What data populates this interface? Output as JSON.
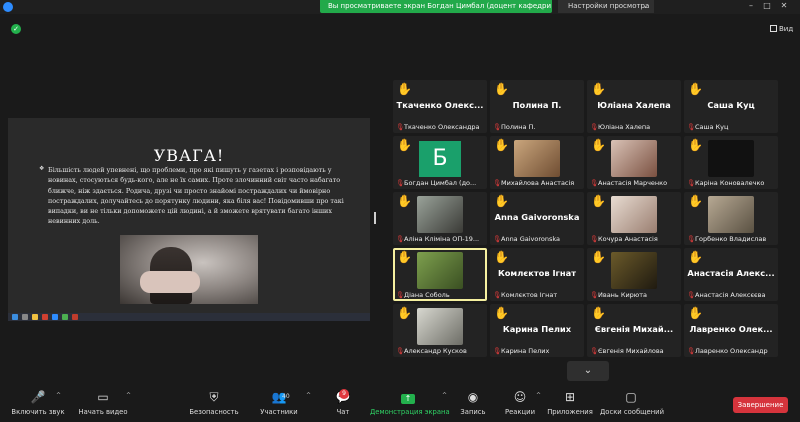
{
  "titlebar": {
    "banner": "Вы просматриваете экран Богдан Цимбал (доцент кафедри ...",
    "view_settings": "Настройки просмотра",
    "view_chevron": "⌄"
  },
  "top": {
    "view_label": "Вид"
  },
  "slide": {
    "title": "УВАГА!",
    "bullet": "❖",
    "text": "Більшість людей упевнені, що проблеми, про які пишуть у газетах і розповідають у новинах, стосуються будь-кого, але не їх самих. Проте злочинний світ часто набагато ближче, ніж здається. Родича, друзі чи просто знайомі постраждалих чи ймовірно постраждалих, долучайтесь до порятунку людини, яка біля вас! Повідомивши про такі випадки, ви не тільки допоможете цій людині, а й зможете врятувати багато інших невинних доль."
  },
  "tiles": [
    {
      "big": "Ткаченко  Олекс...",
      "small": "Ткаченко Олександра"
    },
    {
      "big": "Полина П.",
      "small": "Полина П."
    },
    {
      "big": "Юліана Халепа",
      "small": "Юліана Халепа"
    },
    {
      "big": "Саша Куц",
      "small": "Саша Куц"
    },
    {
      "big": "",
      "small": "Богдан Цимбал (до...",
      "avatar": "Б"
    },
    {
      "big": "",
      "small": "Михайлова Анастасія"
    },
    {
      "big": "",
      "small": "Анастасія Марченко"
    },
    {
      "big": "",
      "small": "Каріна Коновалечко"
    },
    {
      "big": "",
      "small": "Аліна Кліміна ОП-19..."
    },
    {
      "big": "Anna Gaivoronska",
      "small": "Anna Gaivoronska"
    },
    {
      "big": "",
      "small": "Кочура Анастасія"
    },
    {
      "big": "",
      "small": "Горбенко Владислав"
    },
    {
      "big": "",
      "small": "Діана Соболь"
    },
    {
      "big": "Комлєктов Ігнат",
      "small": "Комлєктов Ігнат"
    },
    {
      "big": "",
      "small": "Ивань Кирюта"
    },
    {
      "big": "Анастасія Алекс...",
      "small": "Анастасія Алексєєва"
    },
    {
      "big": "",
      "small": "Александр Кусков"
    },
    {
      "big": "Карина Пелих",
      "small": "Карина Пелих"
    },
    {
      "big": "Євгенія  Михай...",
      "small": "Євгенія Михайлова"
    },
    {
      "big": "Лавренко  Олек...",
      "small": "Лавренко Олександр"
    }
  ],
  "toolbar": {
    "mic": "Включить звук",
    "video": "Начать видео",
    "security": "Безопасность",
    "participants": "Участники",
    "participants_count": "40",
    "chat": "Чат",
    "chat_badge": "9",
    "share": "Демонстрация экрана",
    "record": "Запись",
    "reactions": "Реакции",
    "apps": "Приложения",
    "whiteboard": "Доски сообщений",
    "end": "Завершение"
  },
  "colors": {
    "banner": "#22a94a",
    "end": "#d6343c",
    "hand": "#f7c331",
    "active_outline": "#f5f0a0"
  }
}
